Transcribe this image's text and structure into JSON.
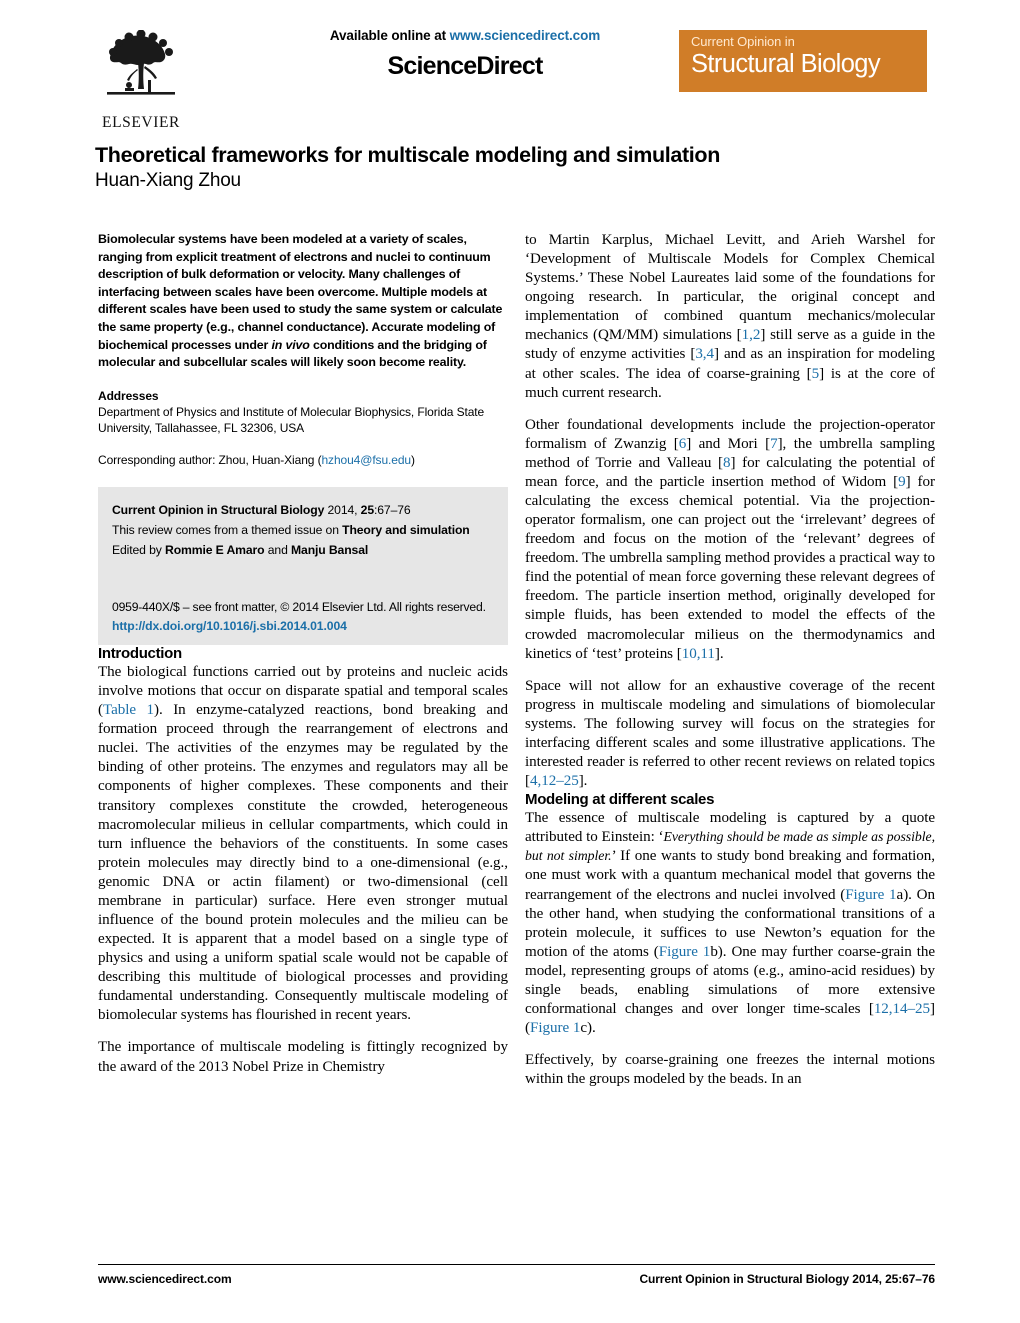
{
  "masthead": {
    "publisher_name": "ELSEVIER",
    "publisher_logo_icon": "elsevier-tree-logo",
    "available_prefix": "Available online at ",
    "available_link": "www.sciencedirect.com",
    "wordmark": "ScienceDirect",
    "journal_badge_line1": "Current Opinion in",
    "journal_badge_line2": "Structural Biology",
    "journal_badge_color": "#d07d28",
    "link_color": "#1b6fa8"
  },
  "article": {
    "title": "Theoretical frameworks for multiscale modeling and simulation",
    "author": "Huan-Xiang Zhou"
  },
  "abstract": {
    "part1": "Biomolecular systems have been modeled at a variety of scales, ranging from explicit treatment of electrons and nuclei to continuum description of bulk deformation or velocity. Many challenges of interfacing between scales have been overcome. Multiple models at different scales have been used to study the same system or calculate the same property (e.g., channel conductance). Accurate modeling of biochemical processes under ",
    "italic": "in vivo",
    "part2": " conditions and the bridging of molecular and subcellular scales will likely soon become reality."
  },
  "addresses": {
    "heading": "Addresses",
    "body": "Department of Physics and Institute of Molecular Biophysics, Florida State University, Tallahassee, FL 32306, USA",
    "corresponding_prefix": "Corresponding author: Zhou, Huan-Xiang (",
    "corresponding_email": "hzhou4@fsu.edu",
    "corresponding_suffix": ")"
  },
  "citation_box": {
    "journal_bold": "Current Opinion in Structural Biology",
    "journal_rest_pre": " 2014, ",
    "journal_volume": "25",
    "journal_pages": ":67–76",
    "themed_prefix": "This review comes from a themed issue on ",
    "themed_bold": "Theory and simulation",
    "edited_prefix": "Edited by ",
    "editor1": "Rommie E Amaro",
    "edited_mid": " and ",
    "editor2": "Manju Bansal",
    "frontmatter": "0959-440X/$ – see front matter, © 2014 Elsevier Ltd. All rights reserved.",
    "doi": "http://dx.doi.org/10.1016/j.sbi.2014.01.004",
    "background_color": "#e6e6e6"
  },
  "left_column": {
    "intro_heading": "Introduction",
    "intro_p1_a": "The biological functions carried out by proteins and nucleic acids involve motions that occur on disparate spatial and temporal scales (",
    "intro_p1_ref": "Table 1",
    "intro_p1_b": "). In enzyme-catalyzed reactions, bond breaking and formation proceed through the rearrangement of electrons and nuclei. The activities of the enzymes may be regulated by the binding of other proteins. The enzymes and regulators may all be components of higher complexes. These components and their transitory complexes constitute the crowded, heterogeneous macromolecular milieus in cellular compartments, which could in turn influence the behaviors of the constituents. In some cases protein molecules may directly bind to a one-dimensional (e.g., genomic DNA or actin filament) or two-dimensional (cell membrane in particular) surface. Here even stronger mutual influence of the bound protein molecules and the milieu can be expected. It is apparent that a model based on a single type of physics and using a uniform spatial scale would not be capable of describing this multitude of biological processes and providing fundamental understanding. Consequently multiscale modeling of biomolecular systems has flourished in recent years.",
    "intro_p2": "The importance of multiscale modeling is fittingly recognized by the award of the 2013 Nobel Prize in Chemistry"
  },
  "right_column": {
    "p1_a": "to Martin Karplus, Michael Levitt, and Arieh Warshel for ‘Development of Multiscale Models for Complex Chemical Systems.’ These Nobel Laureates laid some of the foundations for ongoing research. In particular, the original concept and implementation of combined quantum mechanics/molecular mechanics (QM/MM) simulations [",
    "p1_ref1": "1,2",
    "p1_b": "] still serve as a guide in the study of enzyme activities [",
    "p1_ref2": "3,4",
    "p1_c": "] and as an inspiration for modeling at other scales. The idea of coarse-graining [",
    "p1_ref3": "5",
    "p1_d": "] is at the core of much current research.",
    "p2_a": "Other foundational developments include the projection-operator formalism of Zwanzig [",
    "p2_ref1": "6",
    "p2_b": "] and Mori [",
    "p2_ref2": "7",
    "p2_c": "], the umbrella sampling method of Torrie and Valleau [",
    "p2_ref3": "8",
    "p2_d": "] for calculating the potential of mean force, and the particle insertion method of Widom [",
    "p2_ref4": "9",
    "p2_e": "] for calculating the excess chemical potential. Via the projection-operator formalism, one can project out the ‘irrelevant’ degrees of freedom and focus on the motion of the ‘relevant’ degrees of freedom. The umbrella sampling method provides a practical way to find the potential of mean force governing these relevant degrees of freedom. The particle insertion method, originally developed for simple fluids, has been extended to model the effects of the crowded macromolecular milieus on the thermodynamics and kinetics of ‘test’ proteins [",
    "p2_ref5": "10,11",
    "p2_f": "].",
    "p3_a": "Space will not allow for an exhaustive coverage of the recent progress in multiscale modeling and simulations of biomolecular systems. The following survey will focus on the strategies for interfacing different scales and some illustrative applications. The interested reader is referred to other recent reviews on related topics [",
    "p3_ref1": "4,12–25",
    "p3_b": "].",
    "modeling_heading": "Modeling at different scales",
    "p4_a": "The essence of multiscale modeling is captured by a quote attributed to Einstein: ‘",
    "p4_quote": "Everything should be made as simple as possible, but not simpler.",
    "p4_b": "’ If one wants to study bond breaking and formation, one must work with a quantum mechanical model that governs the rearrangement of the electrons and nuclei involved (",
    "p4_ref1": "Figure 1",
    "p4_c": "a). On the other hand, when studying the conformational transitions of a protein molecule, it suffices to use Newton’s equation for the motion of the atoms (",
    "p4_ref2": "Figure 1",
    "p4_d": "b). One may further coarse-grain the model, representing groups of atoms (e.g., amino-acid residues) by single beads, enabling simulations of more extensive conformational changes and over longer time-scales [",
    "p4_ref3": "12,14–25",
    "p4_e": "] (",
    "p4_ref4": "Figure 1",
    "p4_f": "c).",
    "p5": "Effectively, by coarse-graining one freezes the internal motions within the groups modeled by the beads. In an"
  },
  "footer": {
    "left": "www.sciencedirect.com",
    "right_bold": "Current Opinion in Structural Biology",
    "right_rest_pre": " 2014, ",
    "right_volume": "25",
    "right_pages": ":67–76"
  }
}
